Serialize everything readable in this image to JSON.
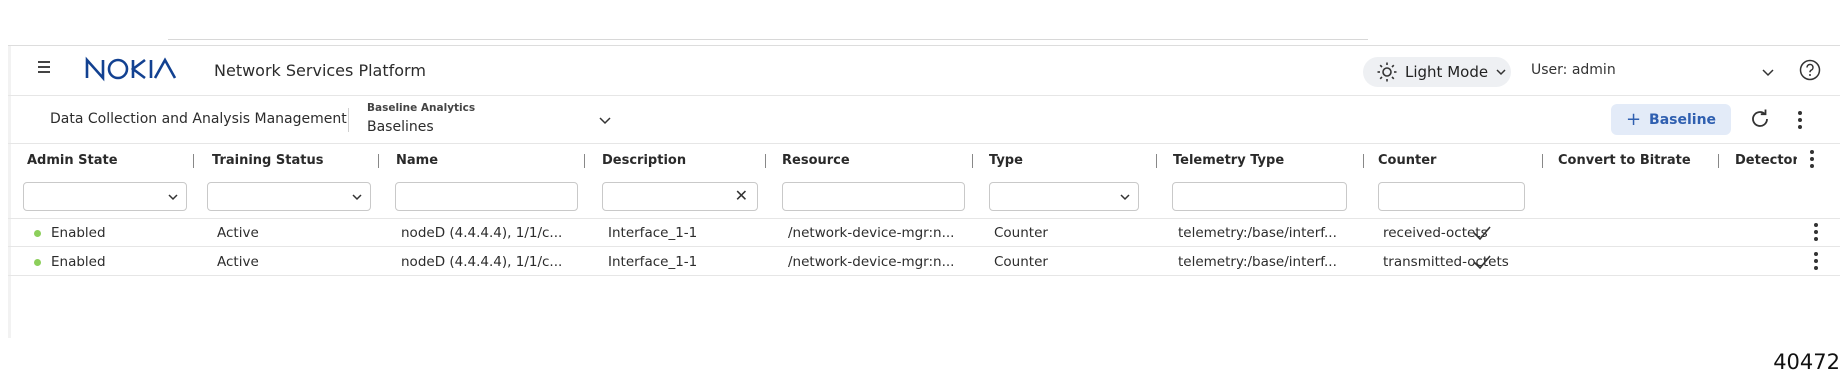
{
  "header": {
    "logo_text": "NOKIA",
    "app_title": "Network Services Platform",
    "mode_label": "Light Mode",
    "user_label": "User: admin"
  },
  "subheader": {
    "breadcrumb": "Data Collection and Analysis Management",
    "section_small": "Baseline Analytics",
    "section_value": "Baselines",
    "add_button": "Baseline"
  },
  "table": {
    "columns": [
      "Admin State",
      "Training Status",
      "Name",
      "Description",
      "Resource",
      "Type",
      "Telemetry Type",
      "Counter",
      "Convert to Bitrate",
      "Detector"
    ],
    "filters": {
      "admin_state": "",
      "training_status": "",
      "name": "",
      "description": "",
      "resource": "",
      "type": "",
      "telemetry_type": "",
      "counter": ""
    },
    "rows": [
      {
        "admin_state": "Enabled",
        "training_status": "Active",
        "name": "nodeD (4.4.4.4), 1/1/c...",
        "description": "Interface_1-1",
        "resource": "/network-device-mgr:n...",
        "type": "Counter",
        "telemetry_type": "telemetry:/base/interf...",
        "counter": "received-octets",
        "convert_to_bitrate": "",
        "detector_checked": true
      },
      {
        "admin_state": "Enabled",
        "training_status": "Active",
        "name": "nodeD (4.4.4.4), 1/1/c...",
        "description": "Interface_1-1",
        "resource": "/network-device-mgr:n...",
        "type": "Counter",
        "telemetry_type": "telemetry:/base/interf...",
        "counter": "transmitted-octets",
        "convert_to_bitrate": "",
        "detector_checked": true
      }
    ]
  },
  "figure_number": "40472",
  "colors": {
    "brand": "#124191",
    "accent": "#2f5fb0",
    "status_enabled": "#8ccf5b"
  }
}
